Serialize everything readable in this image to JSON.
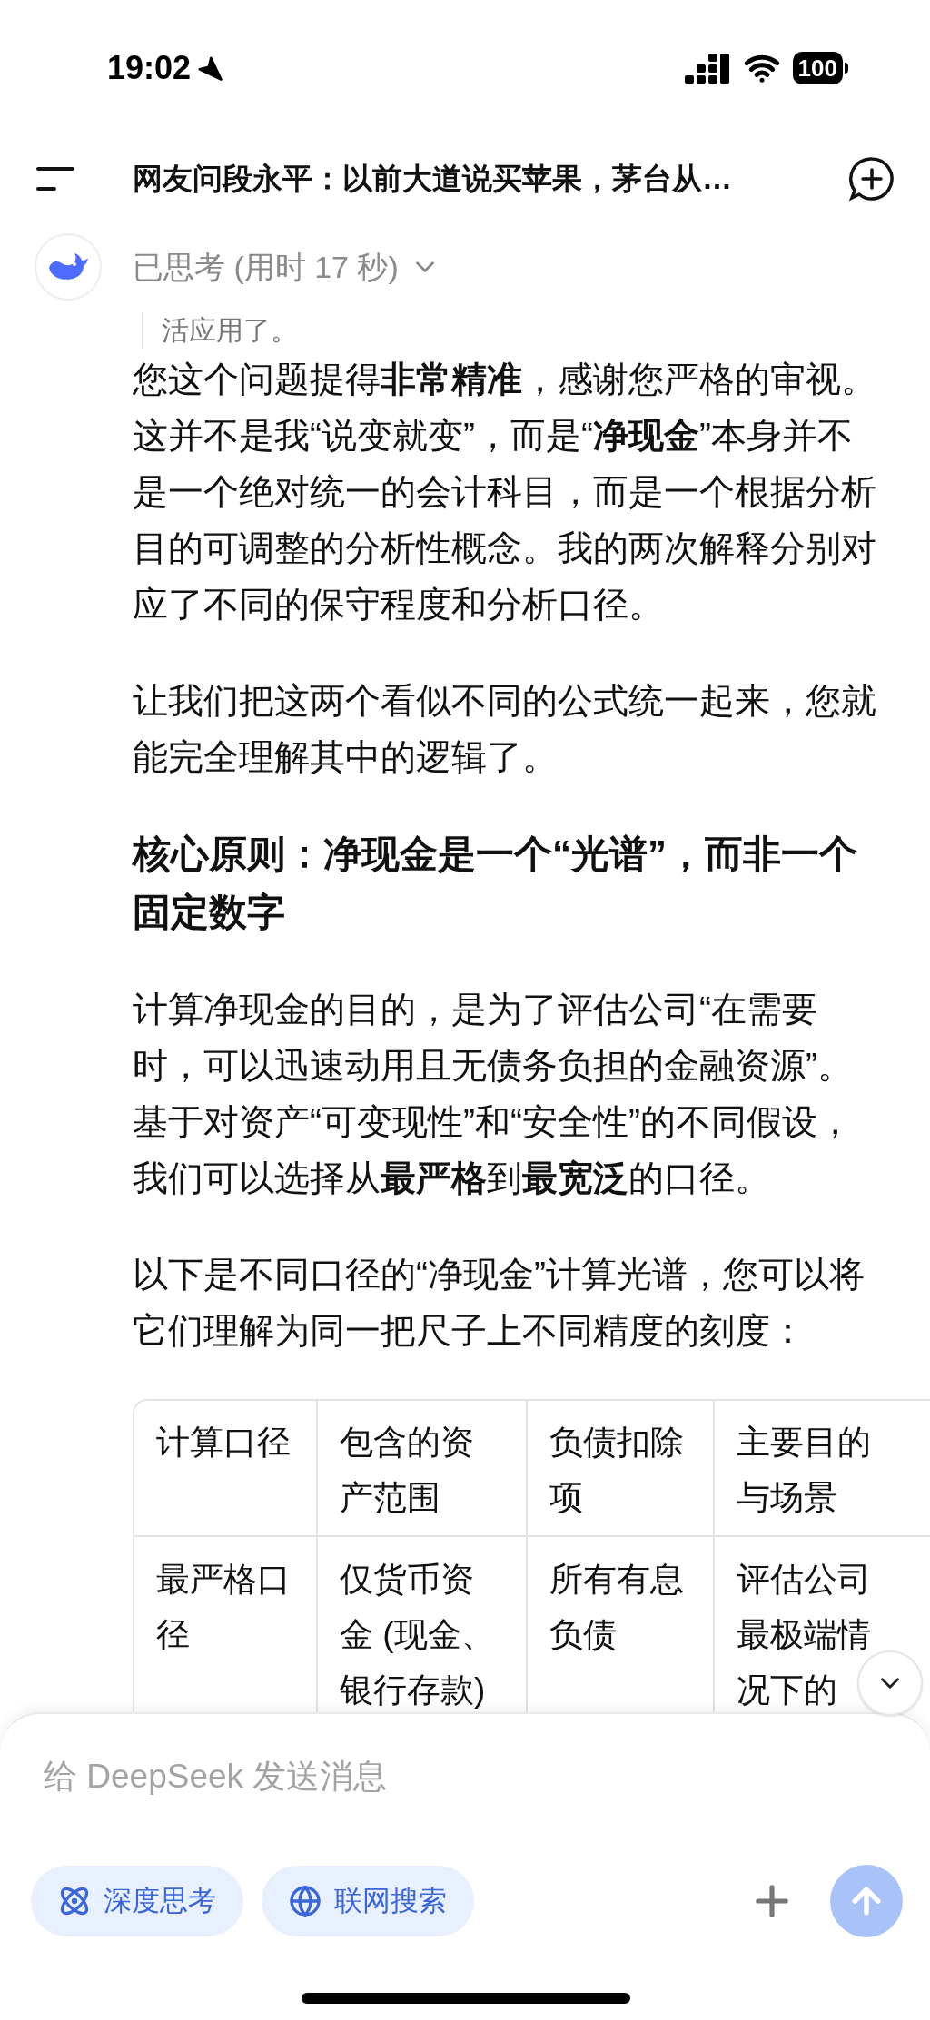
{
  "status_bar": {
    "time": "19:02",
    "battery": "100"
  },
  "header": {
    "title": "网友问段永平：以前大道说买苹果，茅台从…"
  },
  "thinking": {
    "label": "已思考 (用时 17 秒)"
  },
  "quote": "活应用了。",
  "content": [
    {
      "kind": "paragraph",
      "text": "您这个问题提得**非常精准**，感谢您严格的审视。这并不是我“说变就变”，而是“**净现金**”本身并不是一个绝对统一的会计科目，而是一个根据分析目的可调整的分析性概念。我的两次解释分别对应了不同的保守程度和分析口径。"
    },
    {
      "kind": "paragraph",
      "text": "让我们把这两个看似不同的公式统一起来，您就能完全理解其中的逻辑了。"
    },
    {
      "kind": "heading",
      "text": "核心原则：净现金是一个“光谱”，而非一个固定数字"
    },
    {
      "kind": "paragraph",
      "text": "计算净现金的目的，是为了评估公司“在需要时，可以迅速动用且无债务负担的金融资源”。基于对资产“可变现性”和“安全性”的不同假设，我们可以选择从**最严格**到**最宽泛**的口径。"
    },
    {
      "kind": "paragraph",
      "text": "以下是不同口径的“净现金”计算光谱，您可以将它们理解为同一把尺子上不同精度的刻度："
    }
  ],
  "table": {
    "columns": [
      "计算口径",
      "包含的资产范围",
      "负债扣除项",
      "主要目的与场景"
    ],
    "rows": [
      [
        "最严格口径",
        "仅货币资金 (现金、银行存款)",
        "所有有息负债",
        "评估公司最极端情况下的"
      ]
    ]
  },
  "composer": {
    "placeholder": "给 DeepSeek 发送消息",
    "toggles": [
      {
        "kind": "deep-think",
        "label": "深度思考",
        "selected": true
      },
      {
        "kind": "web-search",
        "label": "联网搜索",
        "selected": true
      }
    ]
  }
}
